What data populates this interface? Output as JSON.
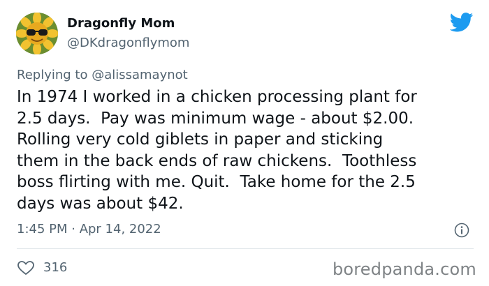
{
  "tweet": {
    "author_name": "Dragonfly Mom",
    "author_handle": "@DKdragonflymom",
    "replying_prefix": "Replying to ",
    "replying_to": "@alissamaynot",
    "text_lines": [
      "In 1974 I worked in a chicken processing plant for",
      "2.5 days.  Pay was minimum wage - about $2.00.",
      "Rolling very cold giblets in paper and sticking",
      "them in the back ends of raw chickens.  Toothless",
      "boss flirting with me. Quit.  Take home for the 2.5",
      "days was about $42."
    ],
    "timestamp": "1:45 PM · Apr 14, 2022",
    "like_count": "316"
  },
  "watermark": "boredpanda.com",
  "icons": {
    "platform": "twitter-bird-icon",
    "info": "info-icon",
    "like": "heart-icon"
  },
  "colors": {
    "brand_blue": "#1d9bf0",
    "secondary_text": "#536471",
    "primary_text": "#0f1419"
  }
}
